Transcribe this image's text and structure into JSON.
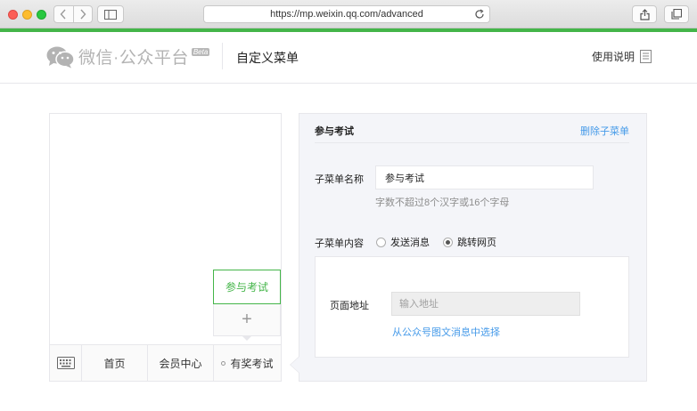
{
  "browser": {
    "url": "https://mp.weixin.qq.com/advanced"
  },
  "header": {
    "logo_text": "微信·公众平台",
    "beta_badge": "Beta",
    "page_title": "自定义菜单",
    "help_label": "使用说明"
  },
  "preview": {
    "menus": [
      {
        "label": "首页"
      },
      {
        "label": "会员中心"
      },
      {
        "label": "有奖考试"
      }
    ],
    "submenu": {
      "active_label": "参与考试",
      "add_symbol": "+"
    }
  },
  "editor": {
    "title": "参与考试",
    "delete_label": "删除子菜单",
    "name_label": "子菜单名称",
    "name_value": "参与考试",
    "name_hint": "字数不超过8个汉字或16个字母",
    "content_label": "子菜单内容",
    "options": [
      {
        "label": "发送消息",
        "checked": false
      },
      {
        "label": "跳转网页",
        "checked": true
      }
    ],
    "url_label": "页面地址",
    "url_placeholder": "输入地址",
    "choose_link": "从公众号图文消息中选择"
  },
  "colors": {
    "brand_green": "#44b549",
    "link_blue": "#459ae9"
  }
}
